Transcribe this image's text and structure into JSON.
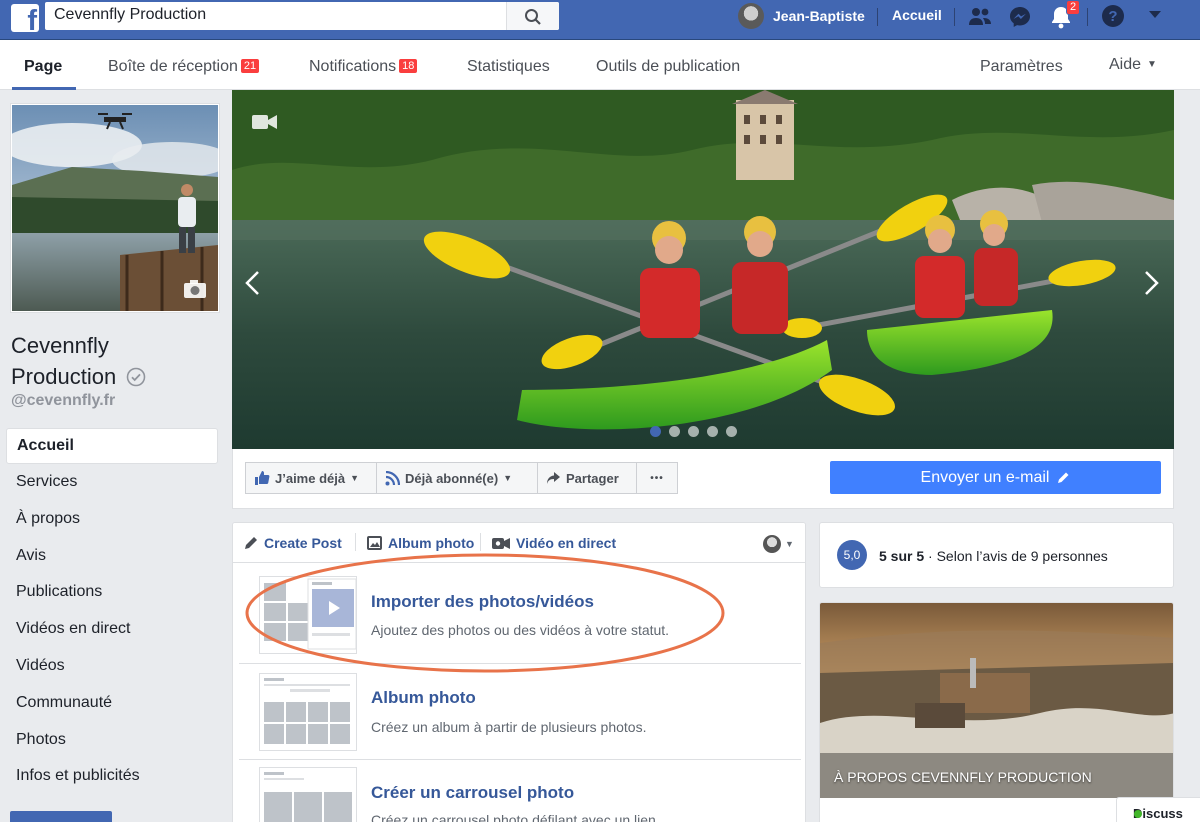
{
  "topbar": {
    "logo": "f",
    "search_value": "Cevennfly Production",
    "user_name": "Jean-Baptiste",
    "home_label": "Accueil",
    "notifications_count": "2"
  },
  "pagenav": {
    "items": [
      {
        "label": "Page"
      },
      {
        "label": "Boîte de réception",
        "badge": "21"
      },
      {
        "label": "Notifications",
        "badge": "18"
      },
      {
        "label": "Statistiques"
      },
      {
        "label": "Outils de publication"
      },
      {
        "label": "Paramètres"
      },
      {
        "label": "Aide"
      }
    ]
  },
  "page": {
    "name_line1": "Cevennfly",
    "name_line2": "Production",
    "handle": "@cevennfly.fr"
  },
  "leftnav": {
    "items": [
      {
        "label": "Accueil"
      },
      {
        "label": "Services"
      },
      {
        "label": "À propos"
      },
      {
        "label": "Avis"
      },
      {
        "label": "Publications"
      },
      {
        "label": "Vidéos en direct"
      },
      {
        "label": "Vidéos"
      },
      {
        "label": "Communauté"
      },
      {
        "label": "Photos"
      },
      {
        "label": "Infos et publicités"
      }
    ]
  },
  "actions": {
    "like": "J’aime déjà",
    "follow": "Déjà abonné(e)",
    "share": "Partager",
    "more": "•••",
    "email": "Envoyer un e-mail"
  },
  "composer": {
    "tabs": [
      "Create Post",
      "Album photo",
      "Vidéo en direct"
    ],
    "options": [
      {
        "title": "Importer des photos/vidéos",
        "desc": "Ajoutez des photos ou des vidéos à votre statut."
      },
      {
        "title": "Album photo",
        "desc": "Créez un album à partir de plusieurs photos."
      },
      {
        "title": "Créer un carrousel photo",
        "desc": "Créez un carrousel photo défilant avec un lien."
      }
    ]
  },
  "rating": {
    "score": "5,0",
    "bold": "5 sur 5",
    "rest": " · Selon l’avis de 9 personnes"
  },
  "about": {
    "title": "À PROPOS CEVENNFLY PRODUCTION"
  },
  "chat": {
    "label": "Discuss"
  },
  "colors": {
    "brand": "#4267b2",
    "link": "#365899",
    "email_button": "#4080ff",
    "badge": "#fa3e3e",
    "highlight": "#e8734a"
  }
}
